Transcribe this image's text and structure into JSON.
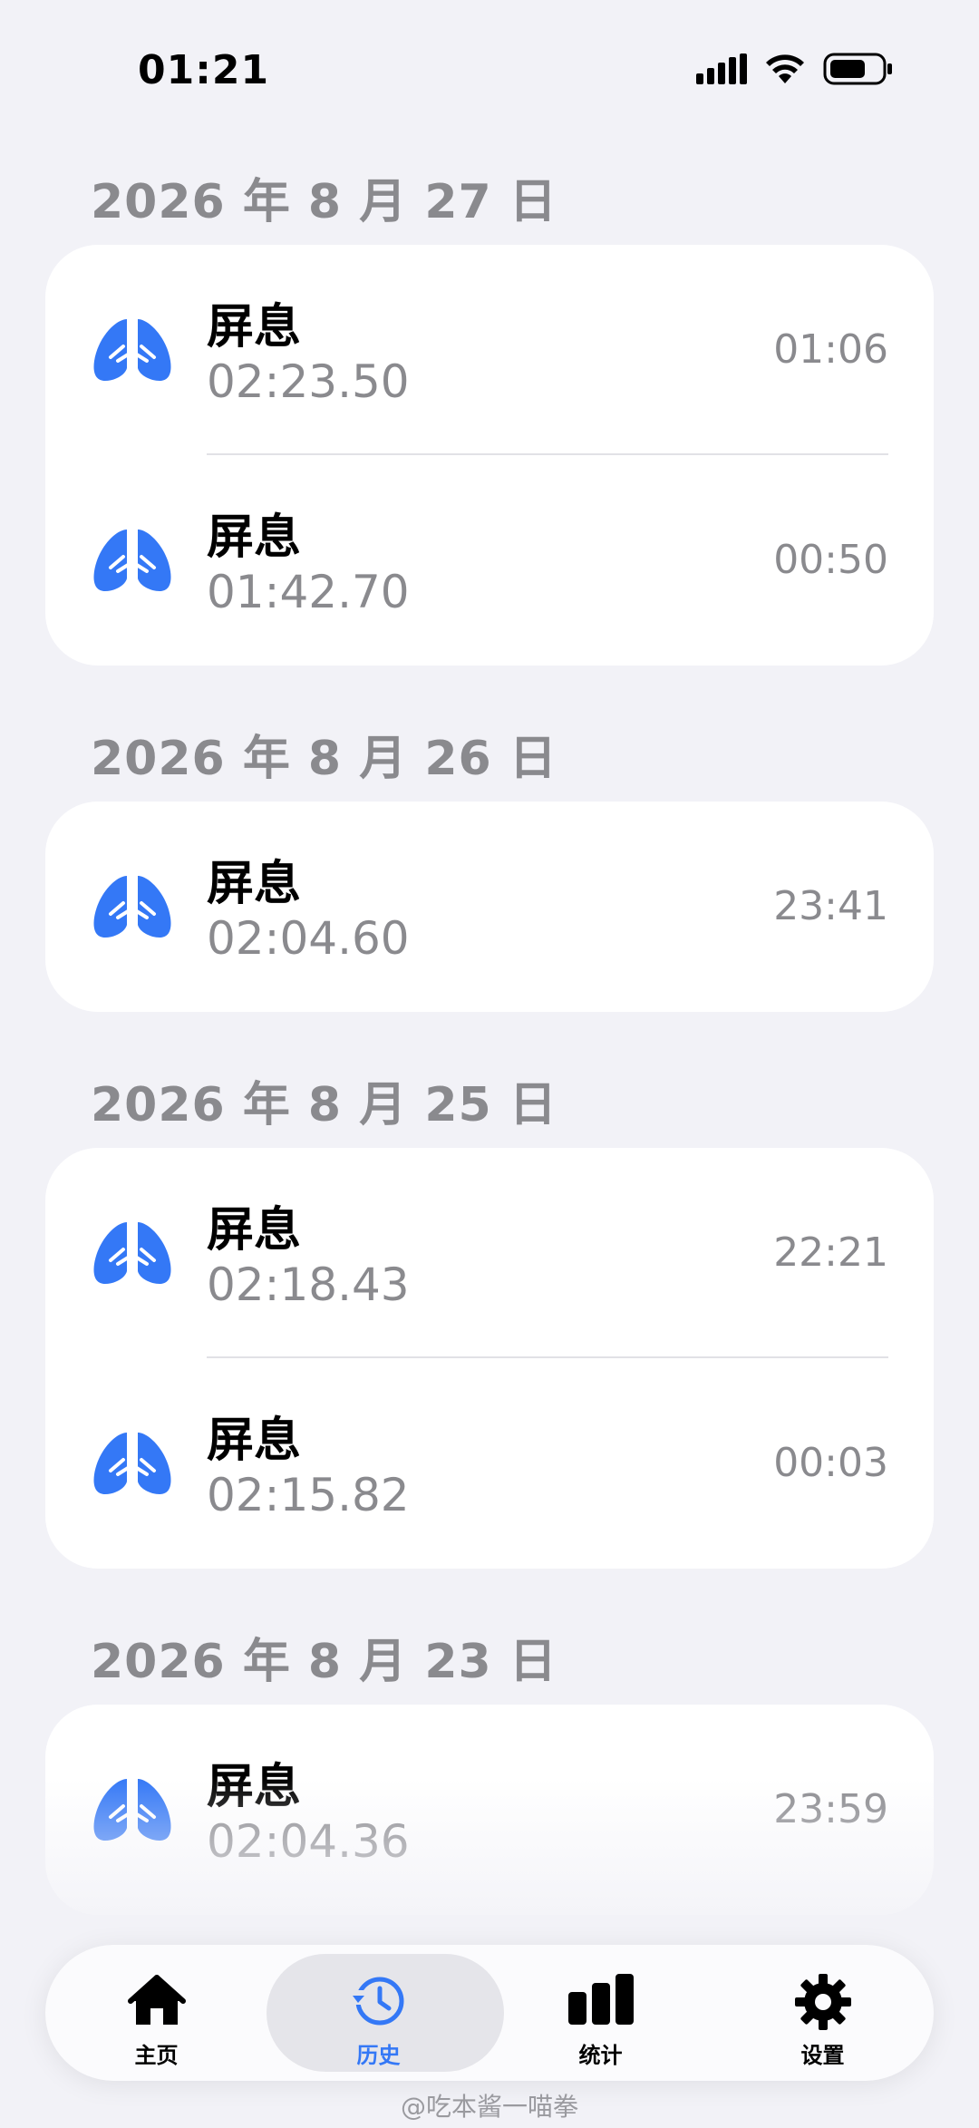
{
  "status_bar": {
    "time": "01:21"
  },
  "colors": {
    "accent": "#3478f6",
    "secondary_text": "#8a8a8e",
    "background": "#f2f2f7"
  },
  "groups": [
    {
      "date": "2026 年 8 月 27 日",
      "items": [
        {
          "title": "屏息",
          "duration": "02:23.50",
          "time": "01:06"
        },
        {
          "title": "屏息",
          "duration": "01:42.70",
          "time": "00:50"
        }
      ]
    },
    {
      "date": "2026 年 8 月 26 日",
      "items": [
        {
          "title": "屏息",
          "duration": "02:04.60",
          "time": "23:41"
        }
      ]
    },
    {
      "date": "2026 年 8 月 25 日",
      "items": [
        {
          "title": "屏息",
          "duration": "02:18.43",
          "time": "22:21"
        },
        {
          "title": "屏息",
          "duration": "02:15.82",
          "time": "00:03"
        }
      ]
    },
    {
      "date": "2026 年 8 月 23 日",
      "items": [
        {
          "title": "屏息",
          "duration": "02:04.36",
          "time": "23:59"
        }
      ]
    }
  ],
  "tabs": [
    {
      "label": "主页",
      "icon": "house-icon"
    },
    {
      "label": "历史",
      "icon": "history-clock-icon",
      "active": true
    },
    {
      "label": "统计",
      "icon": "bar-chart-icon"
    },
    {
      "label": "设置",
      "icon": "gear-icon"
    }
  ],
  "watermark": "@吃本酱一喵拳"
}
